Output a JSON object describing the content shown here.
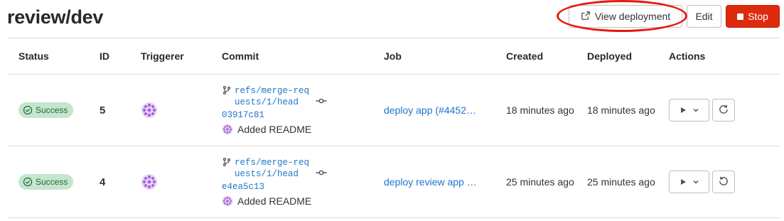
{
  "page": {
    "title": "review/dev"
  },
  "header": {
    "view_deployment_label": "View deployment",
    "edit_label": "Edit",
    "stop_label": "Stop"
  },
  "table": {
    "columns": [
      "Status",
      "ID",
      "Triggerer",
      "Commit",
      "Job",
      "Created",
      "Deployed",
      "Actions"
    ],
    "rows": [
      {
        "status": "Success",
        "id": "5",
        "commit": {
          "ref": "refs/merge-requests/1/head",
          "sha": "03917c81",
          "message": "Added README"
        },
        "job": "deploy app (#4452…",
        "created": "18 minutes ago",
        "deployed": "18 minutes ago",
        "redeploy_icon": "retry-icon"
      },
      {
        "status": "Success",
        "id": "4",
        "commit": {
          "ref": "refs/merge-requests/1/head",
          "sha": "e4ea5c13",
          "message": "Added README"
        },
        "job": "deploy review app …",
        "created": "25 minutes ago",
        "deployed": "25 minutes ago",
        "redeploy_icon": "rollback-icon"
      }
    ]
  },
  "colors": {
    "link": "#1f75cb",
    "success_bg": "#c3e6cd",
    "success_text": "#24663b",
    "danger": "#dd2b0e",
    "annotation": "#e8170b"
  }
}
